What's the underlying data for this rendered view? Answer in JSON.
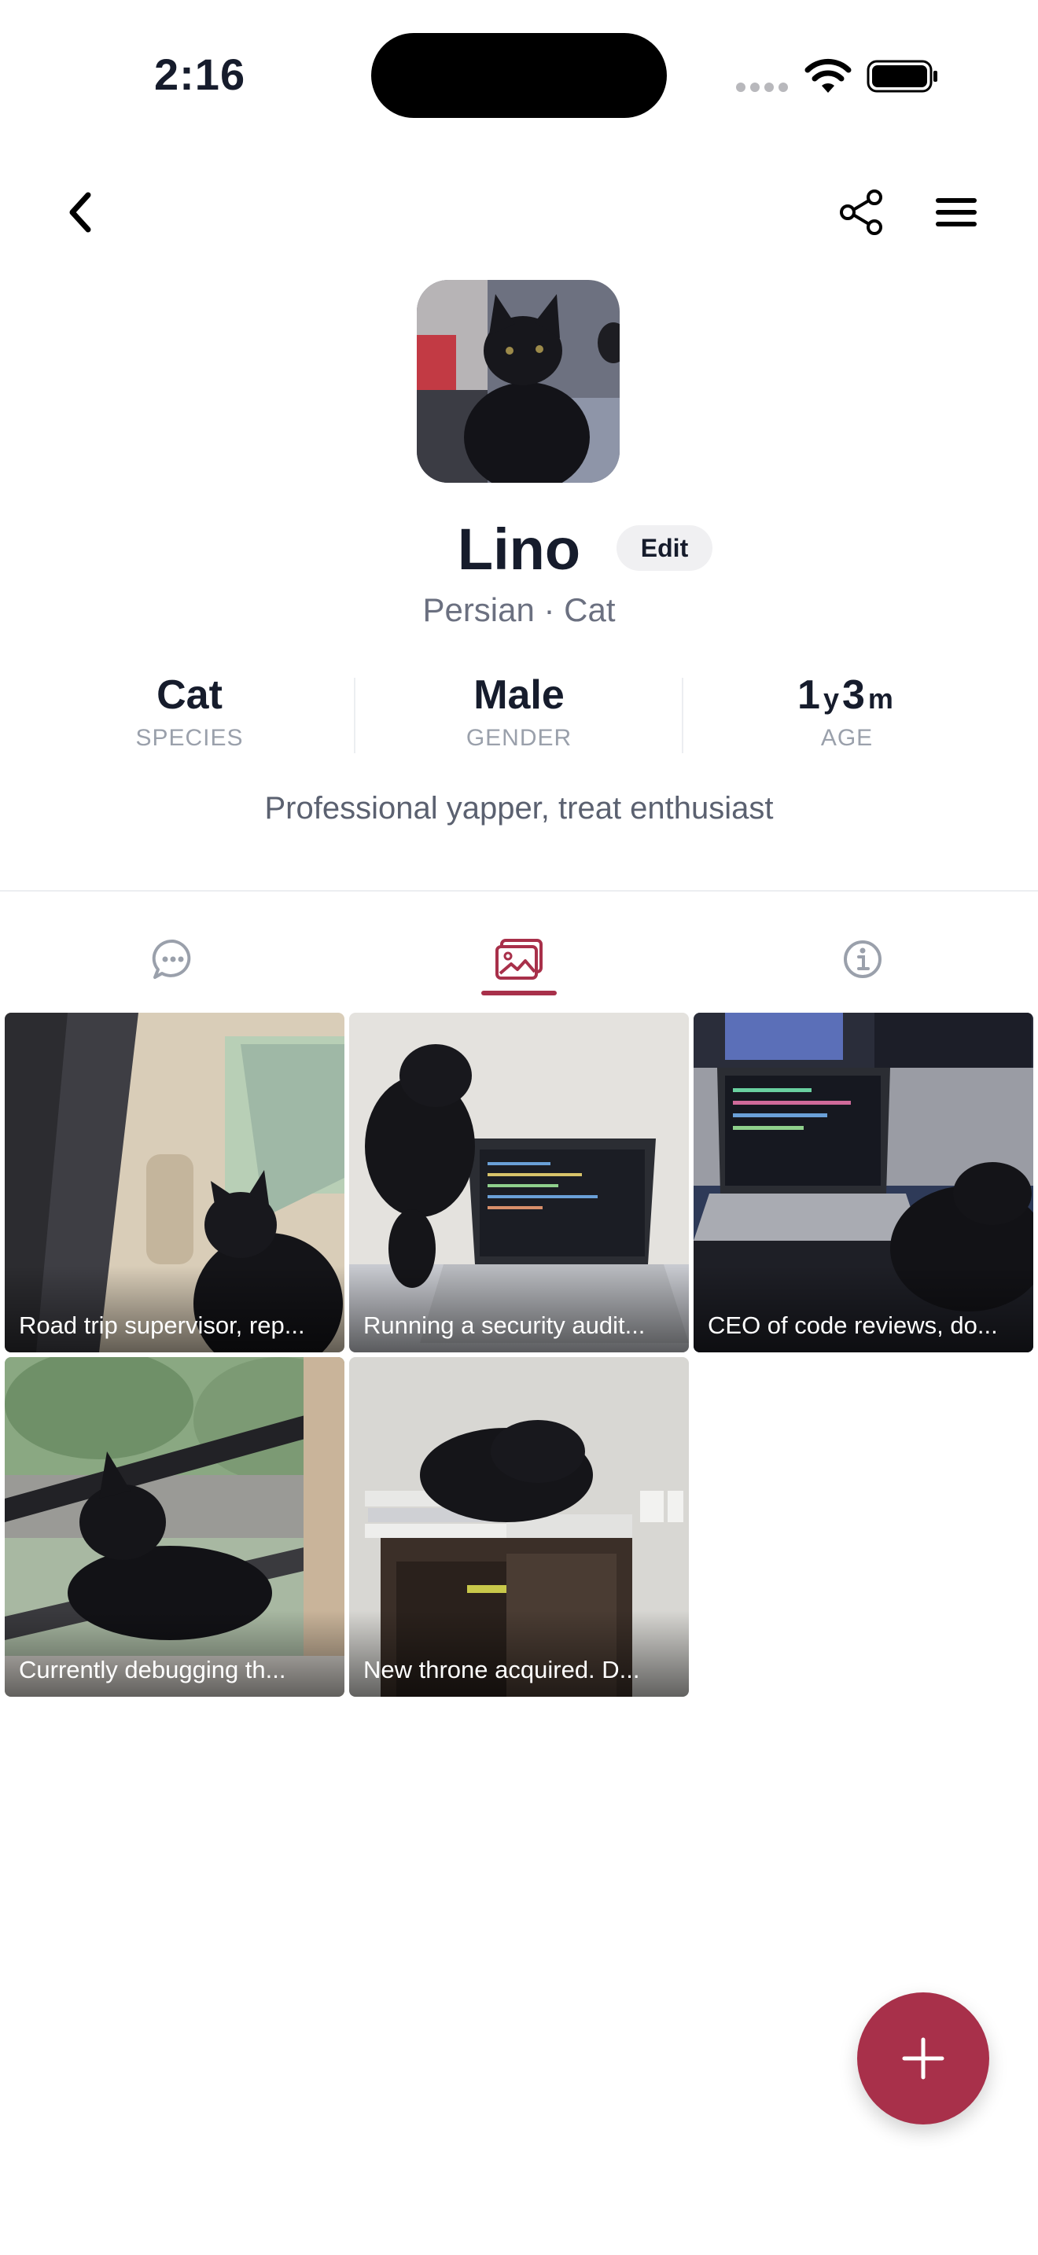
{
  "status_bar": {
    "time": "2:16"
  },
  "profile": {
    "name": "Lino",
    "edit_label": "Edit",
    "breed_line": "Persian · Cat",
    "bio": "Professional yapper, treat enthusiast"
  },
  "stats": {
    "species": {
      "value": "Cat",
      "label": "SPECIES"
    },
    "gender": {
      "value": "Male",
      "label": "GENDER"
    },
    "age": {
      "years": "1",
      "years_unit": "y",
      "months": "3",
      "months_unit": "m",
      "label": "AGE"
    }
  },
  "tabs": [
    {
      "icon": "chat-bubble-icon",
      "active": false
    },
    {
      "icon": "photos-icon",
      "active": true
    },
    {
      "icon": "info-icon",
      "active": false
    }
  ],
  "posts": [
    {
      "caption": "Road trip supervisor, rep..."
    },
    {
      "caption": "Running a security audit..."
    },
    {
      "caption": "CEO of code reviews, do..."
    },
    {
      "caption": "Currently debugging th..."
    },
    {
      "caption": "New throne acquired. D..."
    }
  ],
  "colors": {
    "accent": "#a8304a",
    "text": "#161c2c",
    "muted": "#6b7080"
  }
}
